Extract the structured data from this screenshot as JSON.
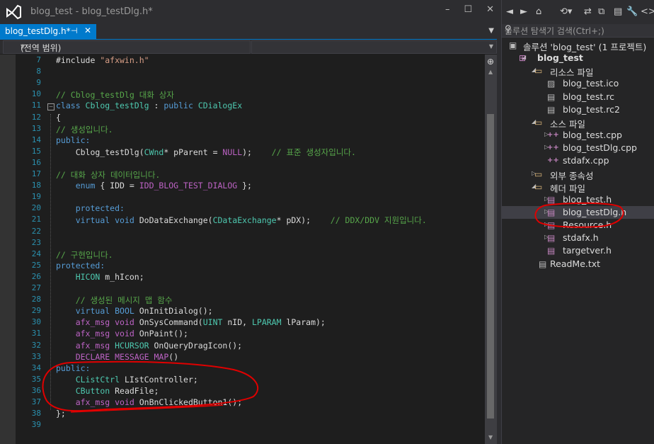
{
  "window": {
    "title": "blog_test - blog_testDlg.h*",
    "controls": [
      "–",
      "☐",
      "✕"
    ]
  },
  "tab": {
    "label": "blog_testDlg.h*",
    "pin": "⊣",
    "close": "✕"
  },
  "navbar": {
    "scope": "(전역 범위)"
  },
  "editor": {
    "line_numbers": [
      "7",
      "8",
      "9",
      "10",
      "11",
      "12",
      "13",
      "14",
      "15",
      "16",
      "17",
      "18",
      "19",
      "20",
      "21",
      "22",
      "23",
      "24",
      "25",
      "26",
      "27",
      "28",
      "29",
      "30",
      "31",
      "32",
      "33",
      "34",
      "35",
      "36",
      "37",
      "38",
      "39"
    ],
    "lines": [
      [
        {
          "t": "#include ",
          "c": "pl"
        },
        {
          "t": "\"afxwin.h\"",
          "c": "st"
        }
      ],
      [],
      [],
      [
        {
          "t": "// Cblog_testDlg 대화 상자",
          "c": "cm"
        }
      ],
      [
        {
          "t": "class ",
          "c": "kw"
        },
        {
          "t": "Cblog_testDlg",
          "c": "ty"
        },
        {
          "t": " : ",
          "c": "pl"
        },
        {
          "t": "public ",
          "c": "kw"
        },
        {
          "t": "CDialogEx",
          "c": "ty"
        }
      ],
      [
        {
          "t": "{",
          "c": "pl"
        }
      ],
      [
        {
          "t": "// 생성입니다.",
          "c": "cm"
        }
      ],
      [
        {
          "t": "public:",
          "c": "kw"
        }
      ],
      [
        {
          "t": "    Cblog_testDlg(",
          "c": "pl"
        },
        {
          "t": "CWnd",
          "c": "ty"
        },
        {
          "t": "* pParent = ",
          "c": "pl"
        },
        {
          "t": "NULL",
          "c": "mac"
        },
        {
          "t": ");    ",
          "c": "pl"
        },
        {
          "t": "// 표준 생성자입니다.",
          "c": "cm"
        }
      ],
      [],
      [
        {
          "t": "// 대화 상자 데이터입니다.",
          "c": "cm"
        }
      ],
      [
        {
          "t": "    ",
          "c": "pl"
        },
        {
          "t": "enum",
          "c": "kw"
        },
        {
          "t": " { IDD = ",
          "c": "pl"
        },
        {
          "t": "IDD_BLOG_TEST_DIALOG",
          "c": "mac"
        },
        {
          "t": " };",
          "c": "pl"
        }
      ],
      [],
      [
        {
          "t": "    ",
          "c": "pl"
        },
        {
          "t": "protected:",
          "c": "kw"
        }
      ],
      [
        {
          "t": "    ",
          "c": "pl"
        },
        {
          "t": "virtual void ",
          "c": "kw"
        },
        {
          "t": "DoDataExchange(",
          "c": "pl"
        },
        {
          "t": "CDataExchange",
          "c": "ty"
        },
        {
          "t": "* pDX);    ",
          "c": "pl"
        },
        {
          "t": "// DDX/DDV 지원입니다.",
          "c": "cm"
        }
      ],
      [],
      [],
      [
        {
          "t": "// 구현입니다.",
          "c": "cm"
        }
      ],
      [
        {
          "t": "protected:",
          "c": "kw"
        }
      ],
      [
        {
          "t": "    ",
          "c": "pl"
        },
        {
          "t": "HICON",
          "c": "ty"
        },
        {
          "t": " m_hIcon;",
          "c": "pl"
        }
      ],
      [],
      [
        {
          "t": "    // 생성된 메시지 맵 함수",
          "c": "cm"
        }
      ],
      [
        {
          "t": "    ",
          "c": "pl"
        },
        {
          "t": "virtual BOOL ",
          "c": "kw"
        },
        {
          "t": "OnInitDialog();",
          "c": "pl"
        }
      ],
      [
        {
          "t": "    ",
          "c": "pl"
        },
        {
          "t": "afx_msg void ",
          "c": "mac"
        },
        {
          "t": "OnSysCommand(",
          "c": "pl"
        },
        {
          "t": "UINT",
          "c": "ty"
        },
        {
          "t": " nID, ",
          "c": "pl"
        },
        {
          "t": "LPARAM",
          "c": "ty"
        },
        {
          "t": " lParam);",
          "c": "pl"
        }
      ],
      [
        {
          "t": "    ",
          "c": "pl"
        },
        {
          "t": "afx_msg void ",
          "c": "mac"
        },
        {
          "t": "OnPaint();",
          "c": "pl"
        }
      ],
      [
        {
          "t": "    ",
          "c": "pl"
        },
        {
          "t": "afx_msg ",
          "c": "mac"
        },
        {
          "t": "HCURSOR",
          "c": "ty"
        },
        {
          "t": " OnQueryDragIcon();",
          "c": "pl"
        }
      ],
      [
        {
          "t": "    ",
          "c": "pl"
        },
        {
          "t": "DECLARE_MESSAGE_MAP",
          "c": "mac"
        },
        {
          "t": "()",
          "c": "pl"
        }
      ],
      [
        {
          "t": "public:",
          "c": "kw"
        }
      ],
      [
        {
          "t": "    ",
          "c": "pl"
        },
        {
          "t": "CListCtrl",
          "c": "ty"
        },
        {
          "t": " LIstController;",
          "c": "pl"
        }
      ],
      [
        {
          "t": "    ",
          "c": "pl"
        },
        {
          "t": "CButton",
          "c": "ty"
        },
        {
          "t": " ReadFile;",
          "c": "pl"
        }
      ],
      [
        {
          "t": "    ",
          "c": "pl"
        },
        {
          "t": "afx_msg void ",
          "c": "mac"
        },
        {
          "t": "OnBnClickedButton1();",
          "c": "pl"
        }
      ],
      [
        {
          "t": "};",
          "c": "pl"
        }
      ],
      []
    ]
  },
  "solution_explorer": {
    "search_placeholder": "솔루션 탐색기 검색(Ctrl+;)",
    "items": [
      {
        "label": "솔루션 'blog_test' (1 프로젝트)",
        "icon": "solution-icon",
        "level": 0,
        "expander": "",
        "bold": false
      },
      {
        "label": "blog_test",
        "icon": "project-icon",
        "level": 1,
        "expander": "◢",
        "bold": true
      },
      {
        "label": "리소스 파일",
        "icon": "folder-icon",
        "level": 2,
        "expander": "◢",
        "bold": false
      },
      {
        "label": "blog_test.ico",
        "icon": "image-file-icon",
        "level": 3,
        "expander": "",
        "bold": false
      },
      {
        "label": "blog_test.rc",
        "icon": "resource-file-icon",
        "level": 3,
        "expander": "",
        "bold": false
      },
      {
        "label": "blog_test.rc2",
        "icon": "resource-file-icon",
        "level": 3,
        "expander": "",
        "bold": false
      },
      {
        "label": "소스 파일",
        "icon": "folder-icon",
        "level": 2,
        "expander": "◢",
        "bold": false
      },
      {
        "label": "blog_test.cpp",
        "icon": "cpp-file-icon",
        "level": 3,
        "expander": "▷",
        "bold": false
      },
      {
        "label": "blog_testDlg.cpp",
        "icon": "cpp-file-icon",
        "level": 3,
        "expander": "▷",
        "bold": false
      },
      {
        "label": "stdafx.cpp",
        "icon": "cpp-file-icon",
        "level": 3,
        "expander": "",
        "bold": false
      },
      {
        "label": "외부 종속성",
        "icon": "dependency-folder-icon",
        "level": 2,
        "expander": "▷",
        "bold": false
      },
      {
        "label": "헤더 파일",
        "icon": "folder-icon",
        "level": 2,
        "expander": "◢",
        "bold": false
      },
      {
        "label": "blog_test.h",
        "icon": "header-file-icon",
        "level": 3,
        "expander": "▷",
        "bold": false
      },
      {
        "label": "blog_testDlg.h",
        "icon": "header-file-icon",
        "level": 3,
        "expander": "▷",
        "bold": false,
        "selected": true
      },
      {
        "label": "Resource.h",
        "icon": "header-file-icon",
        "level": 3,
        "expander": "▷",
        "bold": false
      },
      {
        "label": "stdafx.h",
        "icon": "header-file-icon",
        "level": 3,
        "expander": "▷",
        "bold": false
      },
      {
        "label": "targetver.h",
        "icon": "header-file-icon",
        "level": 3,
        "expander": "",
        "bold": false
      },
      {
        "label": "ReadMe.txt",
        "icon": "text-file-icon",
        "level": 2,
        "expander": "",
        "bold": false
      }
    ]
  },
  "colors": {
    "accent": "#007acc",
    "annotation": "#e00000",
    "keyword": "#569cd6",
    "type": "#4ec9b0",
    "macro": "#bd63c5",
    "comment": "#57a64a",
    "string": "#d69d85"
  }
}
